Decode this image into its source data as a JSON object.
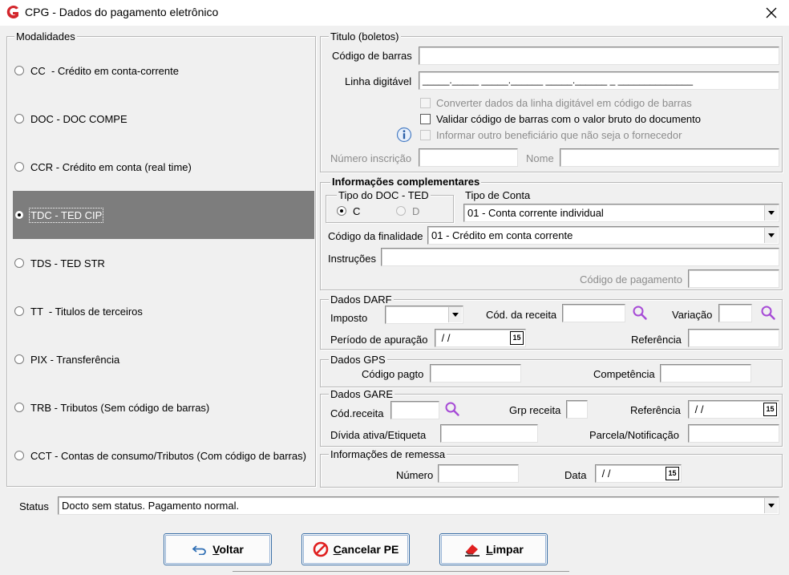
{
  "window": {
    "title": "CPG - Dados do pagamento eletrônico",
    "close_glyph": "✕"
  },
  "modalidades": {
    "legend": "Modalidades",
    "options": [
      {
        "label": "CC  - Crédito em conta-corrente",
        "checked": false
      },
      {
        "label": "DOC - DOC COMPE",
        "checked": false
      },
      {
        "label": "CCR - Crédito em conta (real time)",
        "checked": false
      },
      {
        "label": "TDC - TED CIP",
        "checked": true
      },
      {
        "label": "TDS - TED STR",
        "checked": false
      },
      {
        "label": "TT  - Titulos de terceiros",
        "checked": false
      },
      {
        "label": "PIX - Transferência",
        "checked": false
      },
      {
        "label": "TRB - Tributos (Sem código de barras)",
        "checked": false
      },
      {
        "label": "CCT - Contas de consumo/Tributos (Com código de barras)",
        "checked": false
      }
    ]
  },
  "titulo": {
    "legend": "Titulo (boletos)",
    "codigo_barras_label": "Código de barras",
    "codigo_barras_value": "",
    "linha_digitavel_label": "Linha digitável",
    "linha_digitavel_value": "_____._____ _____.______ _____.______ _ ______________",
    "chk_converter": "Converter dados da linha digitável em código de barras",
    "chk_validar": "Validar código de barras com o valor bruto do documento",
    "chk_informar": "Informar outro beneficiário que não seja o fornecedor",
    "info_icon": "info-icon",
    "numero_inscricao_label": "Número inscrição",
    "nome_label": "Nome"
  },
  "complementares": {
    "legend": "Informações complementares",
    "tipo_doc_ted_legend": "Tipo do DOC - TED",
    "radio_c": "C",
    "radio_d": "D",
    "tipo_conta_label": "Tipo de Conta",
    "tipo_conta_value": "01 - Conta corrente individual",
    "codigo_finalidade_label": "Código da finalidade",
    "codigo_finalidade_value": "01 - Crédito em conta corrente",
    "instrucoes_label": "Instruções",
    "codigo_pagamento_label": "Código de pagamento"
  },
  "darf": {
    "legend": "Dados DARF",
    "imposto_label": "Imposto",
    "cod_receita_label": "Cód. da receita",
    "variacao_label": "Variação",
    "periodo_label": "Período de apuração",
    "periodo_value": " / /",
    "referencia_label": "Referência",
    "cal_glyph": "15"
  },
  "gps": {
    "legend": "Dados GPS",
    "codigo_pagto_label": "Código pagto",
    "competencia_label": "Competência"
  },
  "gare": {
    "legend": "Dados GARE",
    "cod_receita_label": "Cód.receita",
    "grp_receita_label": "Grp receita",
    "referencia_label": "Referência",
    "referencia_value": " / /",
    "divida_label": "Dívida ativa/Etiqueta",
    "parcela_label": "Parcela/Notificação"
  },
  "remessa": {
    "legend": "Informações de remessa",
    "numero_label": "Número",
    "data_label": "Data",
    "data_value": " / /"
  },
  "status": {
    "label": "Status",
    "value": "Docto sem status. Pagamento normal."
  },
  "buttons": {
    "voltar": {
      "hotkey": "V",
      "rest": "oltar"
    },
    "cancelar": {
      "hotkey": "C",
      "rest": "ancelar PE"
    },
    "limpar": {
      "hotkey": "L",
      "rest": "impar"
    }
  },
  "colors": {
    "accent": "#3a6ea5",
    "selection": "#7d7d7d",
    "search_icon": "#a64ad6",
    "logo": "#d3262c"
  }
}
